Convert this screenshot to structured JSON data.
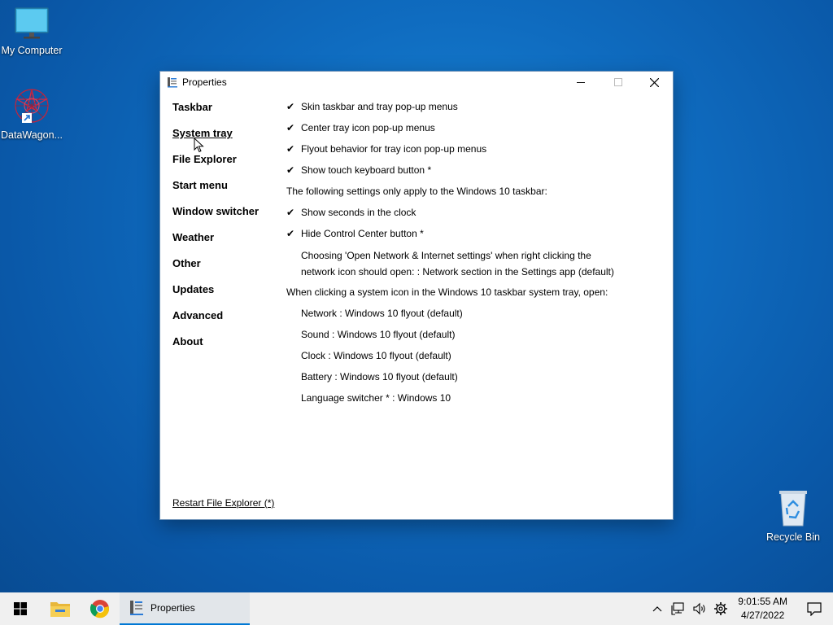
{
  "desktop": {
    "icons": [
      {
        "label": "My Computer"
      },
      {
        "label": "DataWagon..."
      },
      {
        "label": "Recycle Bin"
      }
    ]
  },
  "window": {
    "title": "Properties",
    "nav": [
      "Taskbar",
      "System tray",
      "File Explorer",
      "Start menu",
      "Window switcher",
      "Weather",
      "Other",
      "Updates",
      "Advanced",
      "About"
    ],
    "active_nav": "System tray",
    "settings": {
      "skin_menus": "Skin taskbar and tray pop-up menus",
      "center_menus": "Center tray icon pop-up menus",
      "flyout_behavior": "Flyout behavior for tray icon pop-up menus",
      "touch_keyboard": "Show touch keyboard button *",
      "win10_note": "The following settings only apply to the Windows 10 taskbar:",
      "show_seconds": "Show seconds in the clock",
      "hide_control_center": "Hide Control Center button *",
      "network_choice_line1": "Choosing 'Open Network & Internet settings' when right clicking the",
      "network_choice_line2": "network icon should open: : Network section in the Settings app (default)",
      "system_icon_note": "When clicking a system icon in the Windows 10 taskbar system tray, open:",
      "network": "Network : Windows 10 flyout (default)",
      "sound": "Sound : Windows 10 flyout (default)",
      "clock": "Clock : Windows 10 flyout (default)",
      "battery": "Battery : Windows 10 flyout (default)",
      "language": "Language switcher * : Windows 10"
    },
    "checkmark": "✔",
    "restart_link": "Restart File Explorer (*)"
  },
  "taskbar": {
    "app_label": "Properties",
    "time": "9:01:55 AM",
    "date": "4/27/2022"
  },
  "colors": {
    "accent": "#0078d4",
    "desktop": "#0f6cc0"
  }
}
